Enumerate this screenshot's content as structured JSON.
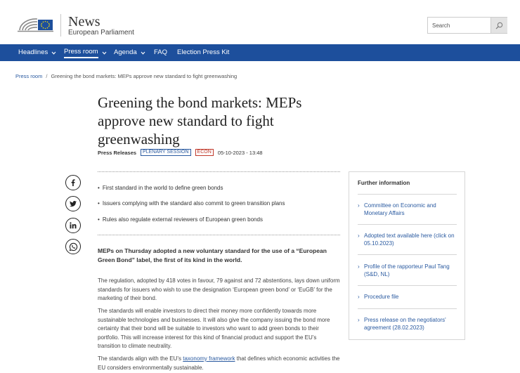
{
  "header": {
    "site_title": "News",
    "site_subtitle": "European Parliament",
    "search_placeholder": "Search"
  },
  "nav": {
    "items": [
      {
        "label": "Headlines",
        "has_menu": true
      },
      {
        "label": "Press room",
        "has_menu": true,
        "active": true
      },
      {
        "label": "Agenda",
        "has_menu": true
      },
      {
        "label": "FAQ",
        "has_menu": false
      },
      {
        "label": "Election Press Kit",
        "has_menu": false
      }
    ]
  },
  "breadcrumb": {
    "parent": "Press room",
    "separator": "/",
    "current": "Greening the bond markets: MEPs approve new standard to fight greenwashing"
  },
  "article": {
    "title": "Greening the bond markets: MEPs approve new standard to fight greenwashing",
    "type": "Press Releases",
    "badges": [
      "PLENARY SESSION",
      "ECON"
    ],
    "date": "05-10-2023 - 13:48",
    "highlights": [
      "First standard in the world to define green bonds",
      "Issuers complying with the standard also commit to green transition plans",
      "Rules also regulate external reviewers of European green bonds"
    ],
    "lead": "MEPs on Thursday adopted a new voluntary standard for the use of a “European Green Bond” label, the first of its kind in the world.",
    "paragraph1": "The regulation, adopted by 418 votes in favour, 79 against and 72 abstentions, lays down uniform standards for issuers who wish to use the designation ‘European green bond’ or ‘EuGB’ for the marketing of their bond.",
    "paragraph2": "The standards will enable investors to direct their money more confidently towards more sustainable technologies and businesses. It will also give the company issuing the bond more certainty that their bond will be suitable to investors who want to add green bonds to their portfolio. This will increase interest for this kind of financial product and support the EU’s transition to climate neutrality.",
    "paragraph3_before": "The standards align with the EU’s ",
    "paragraph3_link": "taxonomy framework",
    "paragraph3_after": " that defines which economic activities the EU considers environmentally sustainable."
  },
  "social": [
    "facebook-icon",
    "twitter-icon",
    "linkedin-icon",
    "whatsapp-icon"
  ],
  "further_info": {
    "title": "Further information",
    "items": [
      "Committee on Economic and Monetary Affairs",
      "Adopted text available here (click on 05.10.2023)",
      "Profile of the rapporteur Paul Tang (S&D, NL)",
      "Procedure file",
      "Press release on the negotiators' agreement (28.02.2023)"
    ]
  },
  "colors": {
    "nav_bg": "#1d4f9c",
    "link": "#2a5aa0",
    "econ_badge": "#c0392b"
  }
}
